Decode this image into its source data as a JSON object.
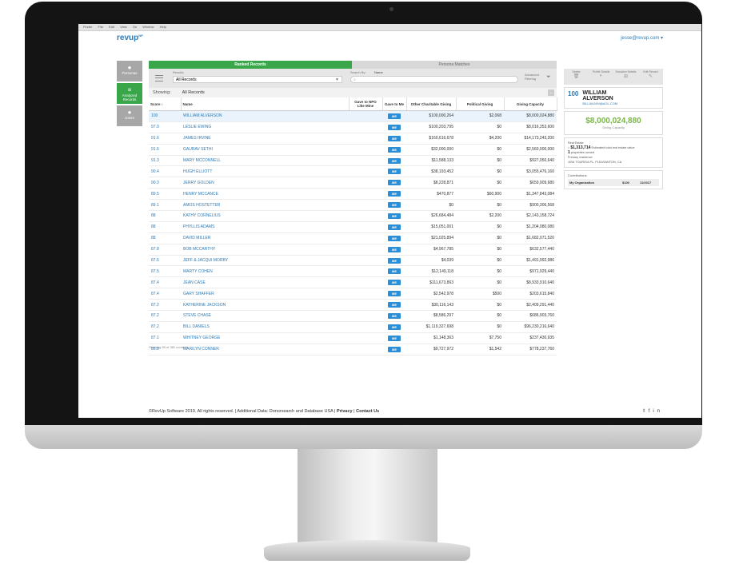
{
  "os_menu": [
    "Finder",
    "File",
    "Edit",
    "View",
    "Go",
    "Window",
    "Help"
  ],
  "app": {
    "logo_text": "revup",
    "logo_suffix": "NP",
    "user_email": "jesse@revup.com",
    "brand_color": "#2a7ab8",
    "accent_color": "#3aa64a"
  },
  "sidebar": [
    {
      "label": "Personas",
      "icon": "person-icon",
      "active": false
    },
    {
      "label": "Analyzed Records",
      "icon": "list-filter-icon",
      "active": true
    },
    {
      "label": "Users",
      "icon": "users-icon",
      "active": false
    }
  ],
  "tabs": [
    "Ranked Records",
    "Persona Matches"
  ],
  "filters": {
    "results_label": "Results:",
    "results_value": "All Records",
    "search_by_label": "Search By:",
    "search_by_value": "Name",
    "search_placeholder": "",
    "advanced_label": "Advanced Filtering"
  },
  "showing": {
    "label": "Showing:",
    "value": "All Records"
  },
  "columns": [
    "Score",
    "Name",
    "Gave to NPO Like Mine",
    "Gave to Me",
    "Other Charitable Giving",
    "Political Giving",
    "Giving Capacity"
  ],
  "rows": [
    {
      "score": "100",
      "name": "WILLIAM ALVERSON",
      "me": "ME",
      "other": "$100,000,264",
      "political": "$2,068",
      "capacity": "$8,000,024,880"
    },
    {
      "score": "97.9",
      "name": "LESLIE EWING",
      "me": "ME",
      "other": "$100,203,795",
      "political": "$0",
      "capacity": "$8,016,353,600"
    },
    {
      "score": "91.6",
      "name": "JAMES IRVINE",
      "me": "ME",
      "other": "$160,616,678",
      "political": "$4,200",
      "capacity": "$14,173,243,200"
    },
    {
      "score": "91.6",
      "name": "GAURAV SETHI",
      "me": "ME",
      "other": "$32,000,000",
      "political": "$0",
      "capacity": "$2,560,000,000"
    },
    {
      "score": "91.3",
      "name": "MARY MCCONNELL",
      "me": "ME",
      "other": "$11,588,133",
      "political": "$0",
      "capacity": "$927,050,640"
    },
    {
      "score": "90.4",
      "name": "HUGH ELLIOTT",
      "me": "ME",
      "other": "$38,193,452",
      "political": "$0",
      "capacity": "$3,055,476,160"
    },
    {
      "score": "90.3",
      "name": "JERRY GOLDEN",
      "me": "ME",
      "other": "$8,228,871",
      "political": "$0",
      "capacity": "$659,909,680"
    },
    {
      "score": "89.5",
      "name": "HENRY MCCANCE",
      "me": "ME",
      "other": "$470,877",
      "political": "$60,900",
      "capacity": "$1,347,843,084"
    },
    {
      "score": "89.1",
      "name": "AMOS HOSTETTER",
      "me": "ME",
      "other": "$0",
      "political": "$0",
      "capacity": "$900,306,568"
    },
    {
      "score": "88",
      "name": "KATHY CORNELIUS",
      "me": "ME",
      "other": "$26,684,484",
      "political": "$2,200",
      "capacity": "$2,143,158,724"
    },
    {
      "score": "88",
      "name": "PHYLLIS ADAMS",
      "me": "ME",
      "other": "$15,051,001",
      "political": "$0",
      "capacity": "$1,204,080,080"
    },
    {
      "score": "88",
      "name": "DAVID MILLER",
      "me": "ME",
      "other": "$21,025,894",
      "political": "$0",
      "capacity": "$1,682,071,520"
    },
    {
      "score": "87.8",
      "name": "BOB MCCARTHY",
      "me": "ME",
      "other": "$4,967,785",
      "political": "$0",
      "capacity": "$632,577,440"
    },
    {
      "score": "87.6",
      "name": "JEFF & JACQUI MORBY",
      "me": "ME",
      "other": "$4,039",
      "political": "$0",
      "capacity": "$1,491,992,986"
    },
    {
      "score": "87.5",
      "name": "MARTY COHEN",
      "me": "ME",
      "other": "$12,149,118",
      "political": "$0",
      "capacity": "$971,929,440"
    },
    {
      "score": "87.4",
      "name": "JEAN CASE",
      "me": "ME",
      "other": "$111,673,863",
      "political": "$0",
      "capacity": "$8,933,910,640"
    },
    {
      "score": "87.4",
      "name": "GARY SHAFFER",
      "me": "ME",
      "other": "$2,542,978",
      "political": "$500",
      "capacity": "$203,615,840"
    },
    {
      "score": "87.2",
      "name": "KATHERINE JACKSON",
      "me": "ME",
      "other": "$30,116,143",
      "political": "$0",
      "capacity": "$2,409,291,440"
    },
    {
      "score": "87.2",
      "name": "STEVE CHASE",
      "me": "ME",
      "other": "$8,586,297",
      "political": "$0",
      "capacity": "$686,903,760"
    },
    {
      "score": "87.2",
      "name": "BILL DANIELS",
      "me": "ME",
      "other": "$1,119,327,698",
      "political": "$0",
      "capacity": "$96,230,216,640"
    },
    {
      "score": "87.1",
      "name": "WHITNEY GEORGE",
      "me": "ME",
      "other": "$1,148,363",
      "political": "$7,750",
      "capacity": "$237,430,935"
    },
    {
      "score": "86.8",
      "name": "MARILYN CONNER",
      "me": "ME",
      "other": "$9,727,972",
      "political": "$1,542",
      "capacity": "$778,237,760"
    }
  ],
  "table_footer": "Showing 50 of 381 contacts",
  "profile": {
    "actions": [
      "Delete",
      "Profile Details",
      "Donation Details",
      "Edit Record"
    ],
    "score": "100",
    "first_name": "WILLIAM",
    "last_name": "ALVERSON",
    "email": "BILLANJAN@AOL.COM",
    "capacity": "$8,000,024,880",
    "capacity_label": "Giving Capacity",
    "real_estate_label": "Real Estate",
    "real_estate_value": "$1,313,714",
    "real_estate_desc": "Estimated total real estate value",
    "properties_count": "1",
    "properties_label": "properties owned",
    "primary_label": "Primary residence",
    "primary_address": "1094 TOURIGA PL, PLEASANTON, CA",
    "contrib_label": "Contributions",
    "contrib_org": "My Organization",
    "contrib_amount": "$100",
    "contrib_date": "11/2017"
  },
  "footer": {
    "copyright": "©RevUp Software 2019. All rights reserved.",
    "data_credit": "Additional Data: Donorsearch and Database USA",
    "privacy": "Privacy",
    "contact": "Contact Us",
    "social": [
      "twitter-icon",
      "facebook-icon",
      "linkedin-icon"
    ]
  }
}
